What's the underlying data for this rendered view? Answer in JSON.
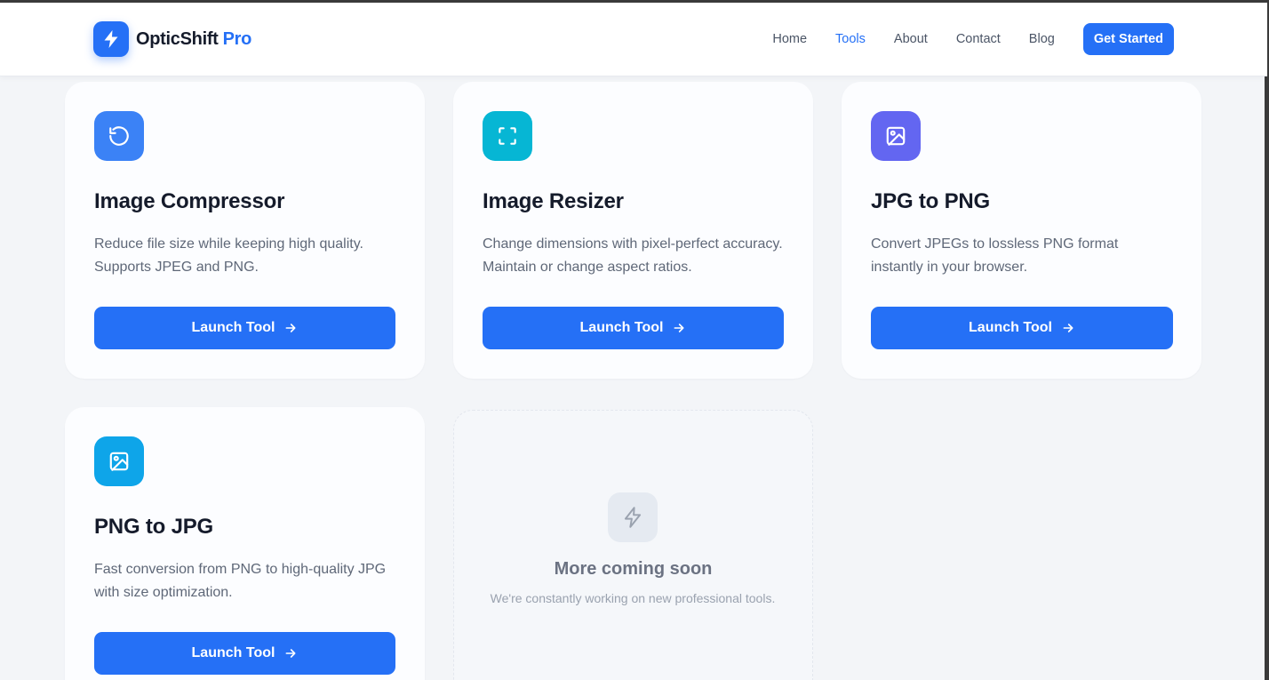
{
  "brand": {
    "name": "OpticShift",
    "accent": "Pro",
    "logo_icon": "lightning-bolt-icon"
  },
  "nav": {
    "items": [
      {
        "label": "Home",
        "active": false
      },
      {
        "label": "Tools",
        "active": true
      },
      {
        "label": "About",
        "active": false
      },
      {
        "label": "Contact",
        "active": false
      },
      {
        "label": "Blog",
        "active": false
      }
    ],
    "cta": "Get Started"
  },
  "tools": [
    {
      "title": "Image Compressor",
      "description": "Reduce file size while keeping high quality. Supports JPEG and PNG.",
      "button": "Launch Tool",
      "icon": "refresh-icon",
      "color": "#3b82f6"
    },
    {
      "title": "Image Resizer",
      "description": "Change dimensions with pixel-perfect accuracy. Maintain or change aspect ratios.",
      "button": "Launch Tool",
      "icon": "resize-frame-icon",
      "color": "#06b6d4"
    },
    {
      "title": "JPG to PNG",
      "description": "Convert JPEGs to lossless PNG format instantly in your browser.",
      "button": "Launch Tool",
      "icon": "image-icon",
      "color": "#6366f1"
    },
    {
      "title": "PNG to JPG",
      "description": "Fast conversion from PNG to high-quality JPG with size optimization.",
      "button": "Launch Tool",
      "icon": "image-icon",
      "color": "#0ea5e9"
    }
  ],
  "coming_soon": {
    "title": "More coming soon",
    "description": "We're constantly working on new professional tools.",
    "icon": "lightning-bolt-icon"
  },
  "colors": {
    "primary": "#2570f6",
    "background": "#f3f5f8"
  }
}
